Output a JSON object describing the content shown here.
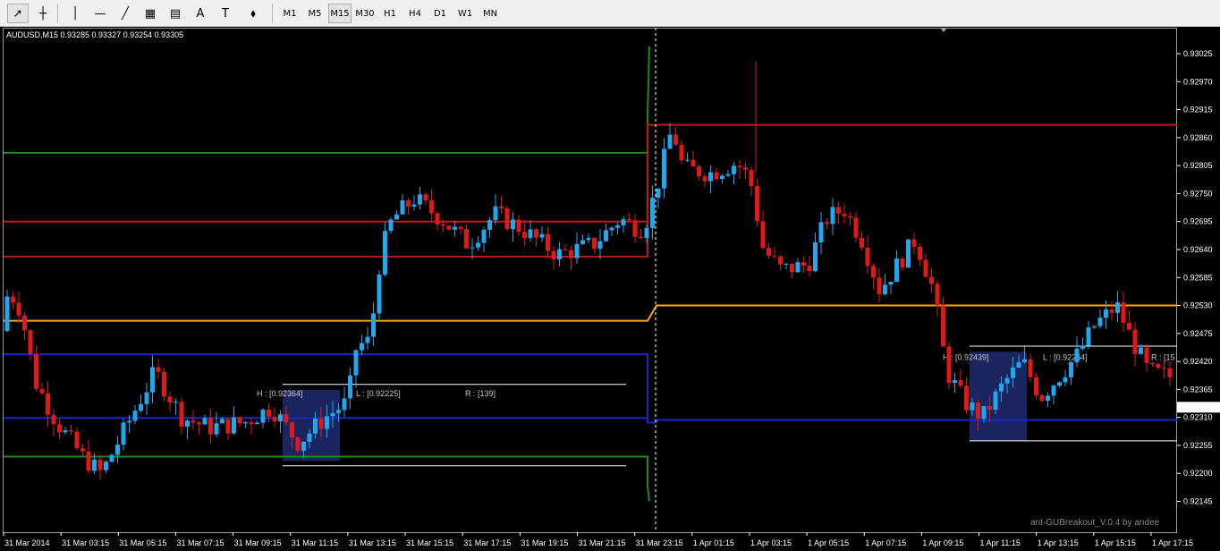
{
  "toolbar": {
    "tools": [
      {
        "name": "cursor-icon",
        "glyph": "➚"
      },
      {
        "name": "crosshair-icon",
        "glyph": "┼"
      },
      {
        "name": "vertical-line-icon",
        "glyph": "│"
      },
      {
        "name": "horizontal-line-icon",
        "glyph": "—"
      },
      {
        "name": "trendline-icon",
        "glyph": "╱"
      },
      {
        "name": "equidistant-channel-icon",
        "glyph": "▦"
      },
      {
        "name": "fibonacci-icon",
        "glyph": "▤"
      },
      {
        "name": "text-icon",
        "glyph": "A"
      },
      {
        "name": "text-label-icon",
        "glyph": "T"
      },
      {
        "name": "arrows-icon",
        "glyph": "⬧"
      }
    ],
    "timeframes": [
      "M1",
      "M5",
      "M15",
      "M30",
      "H1",
      "H4",
      "D1",
      "W1",
      "MN"
    ],
    "active_timeframe": "M15"
  },
  "chart": {
    "symbol_info": "AUDUSD,M15  0.93285 0.93327 0.93254 0.93305",
    "watermark": "ant-GUBreakout_V.0.4 by andee",
    "colors": {
      "bull": "#1ea8f0",
      "bear": "#e01818",
      "background": "#000000",
      "axis_text": "#ffffff",
      "box_fill": "#1e2a6e"
    },
    "price_scale": [
      "0.93025",
      "0.92970",
      "0.92915",
      "0.92860",
      "0.92805",
      "0.92750",
      "0.92695",
      "0.92640",
      "0.92585",
      "0.92530",
      "0.92475",
      "0.92420",
      "0.92365",
      "0.92310",
      "0.92255",
      "0.92200",
      "0.92145"
    ],
    "time_scale": [
      "31 Mar 2014",
      "31 Mar 03:15",
      "31 Mar 05:15",
      "31 Mar 07:15",
      "31 Mar 09:15",
      "31 Mar 11:15",
      "31 Mar 13:15",
      "31 Mar 15:15",
      "31 Mar 17:15",
      "31 Mar 19:15",
      "31 Mar 21:15",
      "31 Mar 23:15",
      "1 Apr 01:15",
      "1 Apr 03:15",
      "1 Apr 05:15",
      "1 Apr 07:15",
      "1 Apr 09:15",
      "1 Apr 11:15",
      "1 Apr 13:15",
      "1 Apr 15:15",
      "1 Apr 17:15"
    ],
    "box_labels_1": {
      "high": "H : [0.92364]",
      "low": "L : [0.92225]",
      "range": "R : [139]"
    },
    "box_labels_2": {
      "high": "H : [0.92439]",
      "low": "L : [0.92264]",
      "range": "R : [15"
    }
  }
}
